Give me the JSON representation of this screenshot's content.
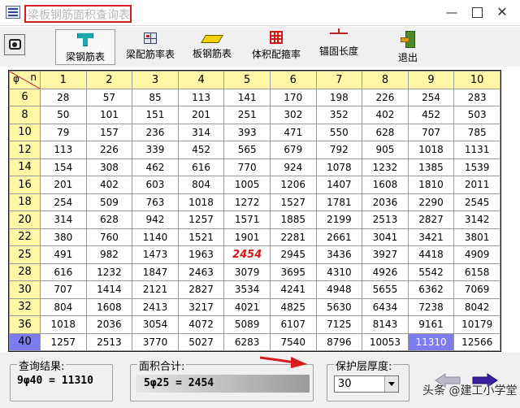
{
  "window": {
    "title": "梁板钢筋面积查询表"
  },
  "toolbar": {
    "buttons": [
      {
        "label": "梁钢筋表",
        "icon": "cube-icon"
      },
      {
        "label": "梁配筋率表",
        "icon": "grid-icon"
      },
      {
        "label": "板钢筋表",
        "icon": "plate-icon"
      },
      {
        "label": "体积配箍率",
        "icon": "rebar-grid-icon"
      },
      {
        "label": "锚固长度",
        "icon": "anchor-icon"
      },
      {
        "label": "退出",
        "icon": "exit-door-icon"
      }
    ]
  },
  "table": {
    "corner_phi": "φ",
    "corner_n": "n",
    "columns": [
      "1",
      "2",
      "3",
      "4",
      "5",
      "6",
      "7",
      "8",
      "9",
      "10"
    ],
    "rows": [
      {
        "d": "6",
        "v": [
          "28",
          "57",
          "85",
          "113",
          "141",
          "170",
          "198",
          "226",
          "254",
          "283"
        ]
      },
      {
        "d": "8",
        "v": [
          "50",
          "101",
          "151",
          "201",
          "251",
          "302",
          "352",
          "402",
          "452",
          "503"
        ]
      },
      {
        "d": "10",
        "v": [
          "79",
          "157",
          "236",
          "314",
          "393",
          "471",
          "550",
          "628",
          "707",
          "785"
        ]
      },
      {
        "d": "12",
        "v": [
          "113",
          "226",
          "339",
          "452",
          "565",
          "679",
          "792",
          "905",
          "1018",
          "1131"
        ]
      },
      {
        "d": "14",
        "v": [
          "154",
          "308",
          "462",
          "616",
          "770",
          "924",
          "1078",
          "1232",
          "1385",
          "1539"
        ]
      },
      {
        "d": "16",
        "v": [
          "201",
          "402",
          "603",
          "804",
          "1005",
          "1206",
          "1407",
          "1608",
          "1810",
          "2011"
        ]
      },
      {
        "d": "18",
        "v": [
          "254",
          "509",
          "763",
          "1018",
          "1272",
          "1527",
          "1781",
          "2036",
          "2290",
          "2545"
        ]
      },
      {
        "d": "20",
        "v": [
          "314",
          "628",
          "942",
          "1257",
          "1571",
          "1885",
          "2199",
          "2513",
          "2827",
          "3142"
        ]
      },
      {
        "d": "22",
        "v": [
          "380",
          "760",
          "1140",
          "1521",
          "1901",
          "2281",
          "2661",
          "3041",
          "3421",
          "3801"
        ]
      },
      {
        "d": "25",
        "v": [
          "491",
          "982",
          "1473",
          "1963",
          "2454",
          "2945",
          "3436",
          "3927",
          "4418",
          "4909"
        ]
      },
      {
        "d": "28",
        "v": [
          "616",
          "1232",
          "1847",
          "2463",
          "3079",
          "3695",
          "4310",
          "4926",
          "5542",
          "6158"
        ]
      },
      {
        "d": "30",
        "v": [
          "707",
          "1414",
          "2121",
          "2827",
          "3534",
          "4241",
          "4948",
          "5655",
          "6362",
          "7069"
        ]
      },
      {
        "d": "32",
        "v": [
          "804",
          "1608",
          "2413",
          "3217",
          "4021",
          "4825",
          "5630",
          "6434",
          "7238",
          "8042"
        ]
      },
      {
        "d": "36",
        "v": [
          "1018",
          "2036",
          "3054",
          "4072",
          "5089",
          "6107",
          "7125",
          "8143",
          "9161",
          "10179"
        ]
      },
      {
        "d": "40",
        "v": [
          "1257",
          "2513",
          "3770",
          "5027",
          "6283",
          "7540",
          "8796",
          "10053",
          "11310",
          "12566"
        ]
      }
    ],
    "selected_row_index": 14,
    "selected_col_index": 8,
    "highlight_row_index": 9,
    "highlight_col_index": 4
  },
  "query_result": {
    "label": "查询结果:",
    "value": "9φ40 = 11310"
  },
  "area_sum": {
    "label": "面积合计:",
    "value": "5φ25 = 2454"
  },
  "cover": {
    "label": "保护层厚度:",
    "value": "30"
  },
  "watermark": "头条 @建工小学堂",
  "colors": {
    "header_bg": "#fff7a6",
    "selection": "#7c7cf0",
    "highlight_text": "#d01a1a",
    "title_frame": "#d21e1e"
  }
}
